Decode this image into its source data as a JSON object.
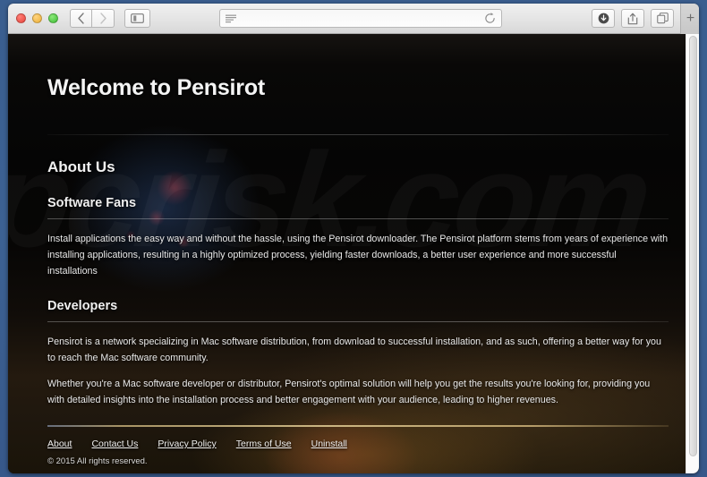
{
  "browser": {
    "window_controls": [
      {
        "name": "close",
        "color": "#e8443c"
      },
      {
        "name": "minimize",
        "color": "#edb037"
      },
      {
        "name": "zoom",
        "color": "#3fbd36"
      }
    ],
    "back_icon": "chevron-left-icon",
    "forward_icon": "chevron-right-icon",
    "sidebar_icon": "sidebar-toggle-icon",
    "address": {
      "value": "",
      "placeholder": "",
      "reader_icon": "reader-lines-icon",
      "reload_icon": "reload-icon"
    },
    "downloads_icon": "downloads-icon",
    "share_icon": "share-icon",
    "tabs_icon": "show-tabs-icon",
    "new_tab_label": "+"
  },
  "page": {
    "watermark": "pcrisk.com",
    "title": "Welcome to Pensirot",
    "about_heading": "About Us",
    "sections": [
      {
        "title": "Software Fans",
        "paragraphs": [
          "Install applications the easy way and without the hassle, using the Pensirot downloader. The Pensirot platform stems from years of experience with installing applications, resulting in a highly optimized process, yielding faster downloads, a better user experience and more successful installations"
        ]
      },
      {
        "title": "Developers",
        "paragraphs": [
          "Pensirot is a network specializing in Mac software distribution, from download to successful installation, and as such, offering a better way for you to reach the Mac software community.",
          "Whether you're a Mac software developer or distributor, Pensirot's optimal solution will help you get the results you're looking for, providing you with detailed insights into the installation process and better engagement with your audience, leading to higher revenues."
        ]
      }
    ],
    "footer": {
      "links": [
        {
          "label": "About"
        },
        {
          "label": "Contact Us"
        },
        {
          "label": "Privacy Policy"
        },
        {
          "label": "Terms of Use"
        },
        {
          "label": "Uninstall"
        }
      ],
      "copyright": "© 2015 All rights reserved."
    }
  },
  "colors": {
    "desktop_blue": "#3c6091",
    "page_background": "#050505",
    "text_primary": "#f2f2f2",
    "footer_rule": "#e2cd96"
  }
}
